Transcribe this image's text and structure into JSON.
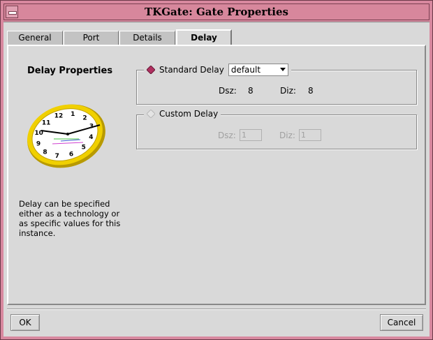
{
  "window": {
    "title": "TKGate: Gate Properties"
  },
  "tabs": [
    {
      "label": "General",
      "active": false
    },
    {
      "label": "Port",
      "active": false
    },
    {
      "label": "Details",
      "active": false
    },
    {
      "label": "Delay",
      "active": true
    }
  ],
  "left_panel": {
    "heading": "Delay Properties",
    "description": "Delay can be specified either as a technology or as specific values for this instance."
  },
  "clock_numbers": [
    "12",
    "1",
    "2",
    "3",
    "4",
    "5",
    "6",
    "7",
    "8",
    "9",
    "10",
    "11"
  ],
  "standard_delay": {
    "label": "Standard Delay",
    "selected": true,
    "technology": "default",
    "dsz_label": "Dsz:",
    "dsz_value": "8",
    "diz_label": "Diz:",
    "diz_value": "8"
  },
  "custom_delay": {
    "label": "Custom Delay",
    "selected": false,
    "dsz_label": "Dsz:",
    "dsz_value": "1",
    "diz_label": "Diz:",
    "diz_value": "1"
  },
  "buttons": {
    "ok": "OK",
    "cancel": "Cancel"
  },
  "colors": {
    "frame": "#d8889f",
    "radio_selected": "#b03060",
    "background": "#d9d9d9"
  }
}
